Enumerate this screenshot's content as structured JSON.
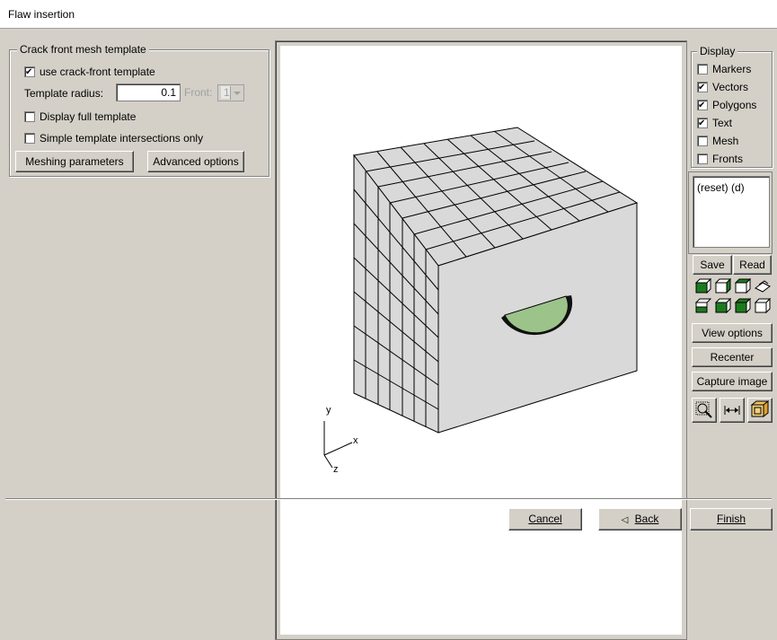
{
  "window": {
    "title": "Flaw insertion"
  },
  "crack_front": {
    "legend": "Crack front mesh template",
    "use_template": {
      "label": "use crack-front template",
      "checked": true
    },
    "template_radius": {
      "label": "Template radius:",
      "value": "0.1"
    },
    "front": {
      "label": "Front:",
      "value": "1"
    },
    "display_full": {
      "label": "Display full template",
      "checked": false
    },
    "simple_intersections": {
      "label": "Simple template intersections only",
      "checked": false
    },
    "meshing_button": "Meshing parameters",
    "advanced_button": "Advanced options"
  },
  "viewport": {
    "axis_labels": {
      "y": "y",
      "x": "x",
      "z": "z"
    },
    "colors": {
      "background": "#ffffff",
      "cube_face": "#d9d9d9",
      "flaw": "#9bc38a"
    }
  },
  "display": {
    "legend": "Display",
    "options": [
      {
        "label": "Markers",
        "checked": false
      },
      {
        "label": "Vectors",
        "checked": true
      },
      {
        "label": "Polygons",
        "checked": true
      },
      {
        "label": "Text",
        "checked": true
      },
      {
        "label": "Mesh",
        "checked": false
      },
      {
        "label": "Fronts",
        "checked": false
      }
    ]
  },
  "views_list": {
    "items": [
      "(reset) (d)"
    ]
  },
  "view_controls": {
    "save": "Save",
    "read": "Read",
    "view_icons": [
      "front-view-icon",
      "back-view-icon",
      "left-view-icon",
      "iso-view-icon",
      "right-view-icon",
      "top-view-icon",
      "bottom-view-icon",
      "iso2-view-icon"
    ],
    "view_options": "View options",
    "recenter": "Recenter",
    "capture": "Capture image",
    "tools": [
      "zoom-icon",
      "measure-icon",
      "bounding-box-icon"
    ]
  },
  "footer": {
    "cancel": "Cancel",
    "back": "Back",
    "finish": "Finish"
  }
}
